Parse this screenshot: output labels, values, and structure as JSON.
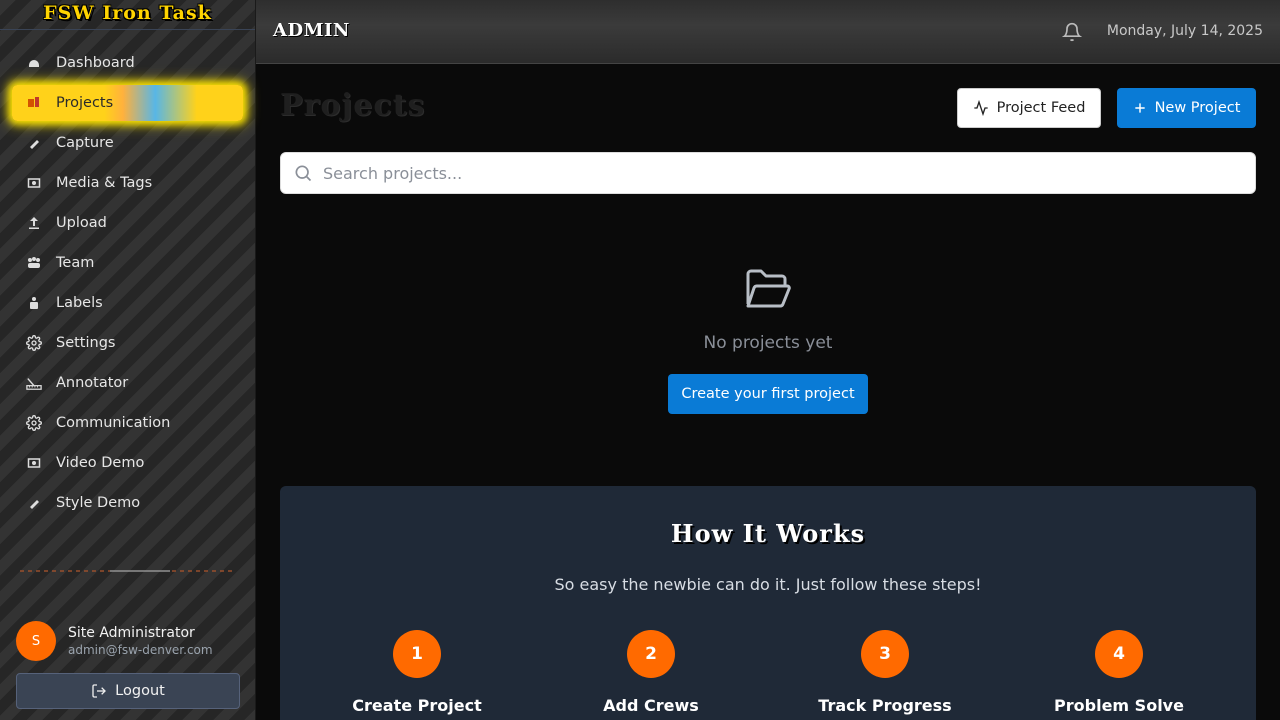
{
  "sidebar": {
    "brand": "FSW Iron Task",
    "items": [
      {
        "label": "Dashboard",
        "icon": "helmet-icon"
      },
      {
        "label": "Projects",
        "icon": "projects-icon"
      },
      {
        "label": "Capture",
        "icon": "capture-icon"
      },
      {
        "label": "Media & Tags",
        "icon": "media-icon"
      },
      {
        "label": "Upload",
        "icon": "upload-icon"
      },
      {
        "label": "Team",
        "icon": "team-icon"
      },
      {
        "label": "Labels",
        "icon": "labels-icon"
      },
      {
        "label": "Settings",
        "icon": "gear-icon"
      },
      {
        "label": "Annotator",
        "icon": "ruler-icon"
      },
      {
        "label": "Communication",
        "icon": "gear-icon"
      },
      {
        "label": "Video Demo",
        "icon": "media-icon"
      },
      {
        "label": "Style Demo",
        "icon": "capture-icon"
      }
    ],
    "active": "Projects",
    "user": {
      "initial": "S",
      "name": "Site Administrator",
      "email": "admin@fsw-denver.com"
    },
    "logout_label": "Logout"
  },
  "topbar": {
    "title": "ADMIN",
    "date": "Monday, July 14, 2025"
  },
  "main": {
    "page_title": "Projects",
    "project_feed_label": "Project Feed",
    "new_project_label": "New Project",
    "search_placeholder": "Search projects...",
    "empty_text": "No projects yet",
    "create_first_label": "Create your first project"
  },
  "how_it_works": {
    "title": "How It Works",
    "subtitle": "So easy the newbie can do it. Just follow these steps!",
    "steps": [
      {
        "num": "1",
        "label": "Create Project"
      },
      {
        "num": "2",
        "label": "Add Crews"
      },
      {
        "num": "3",
        "label": "Track Progress"
      },
      {
        "num": "4",
        "label": "Problem Solve"
      }
    ]
  },
  "colors": {
    "accent_blue": "#0a7bd6",
    "accent_orange": "#ff6a00",
    "brand_yellow": "#ffd400"
  }
}
